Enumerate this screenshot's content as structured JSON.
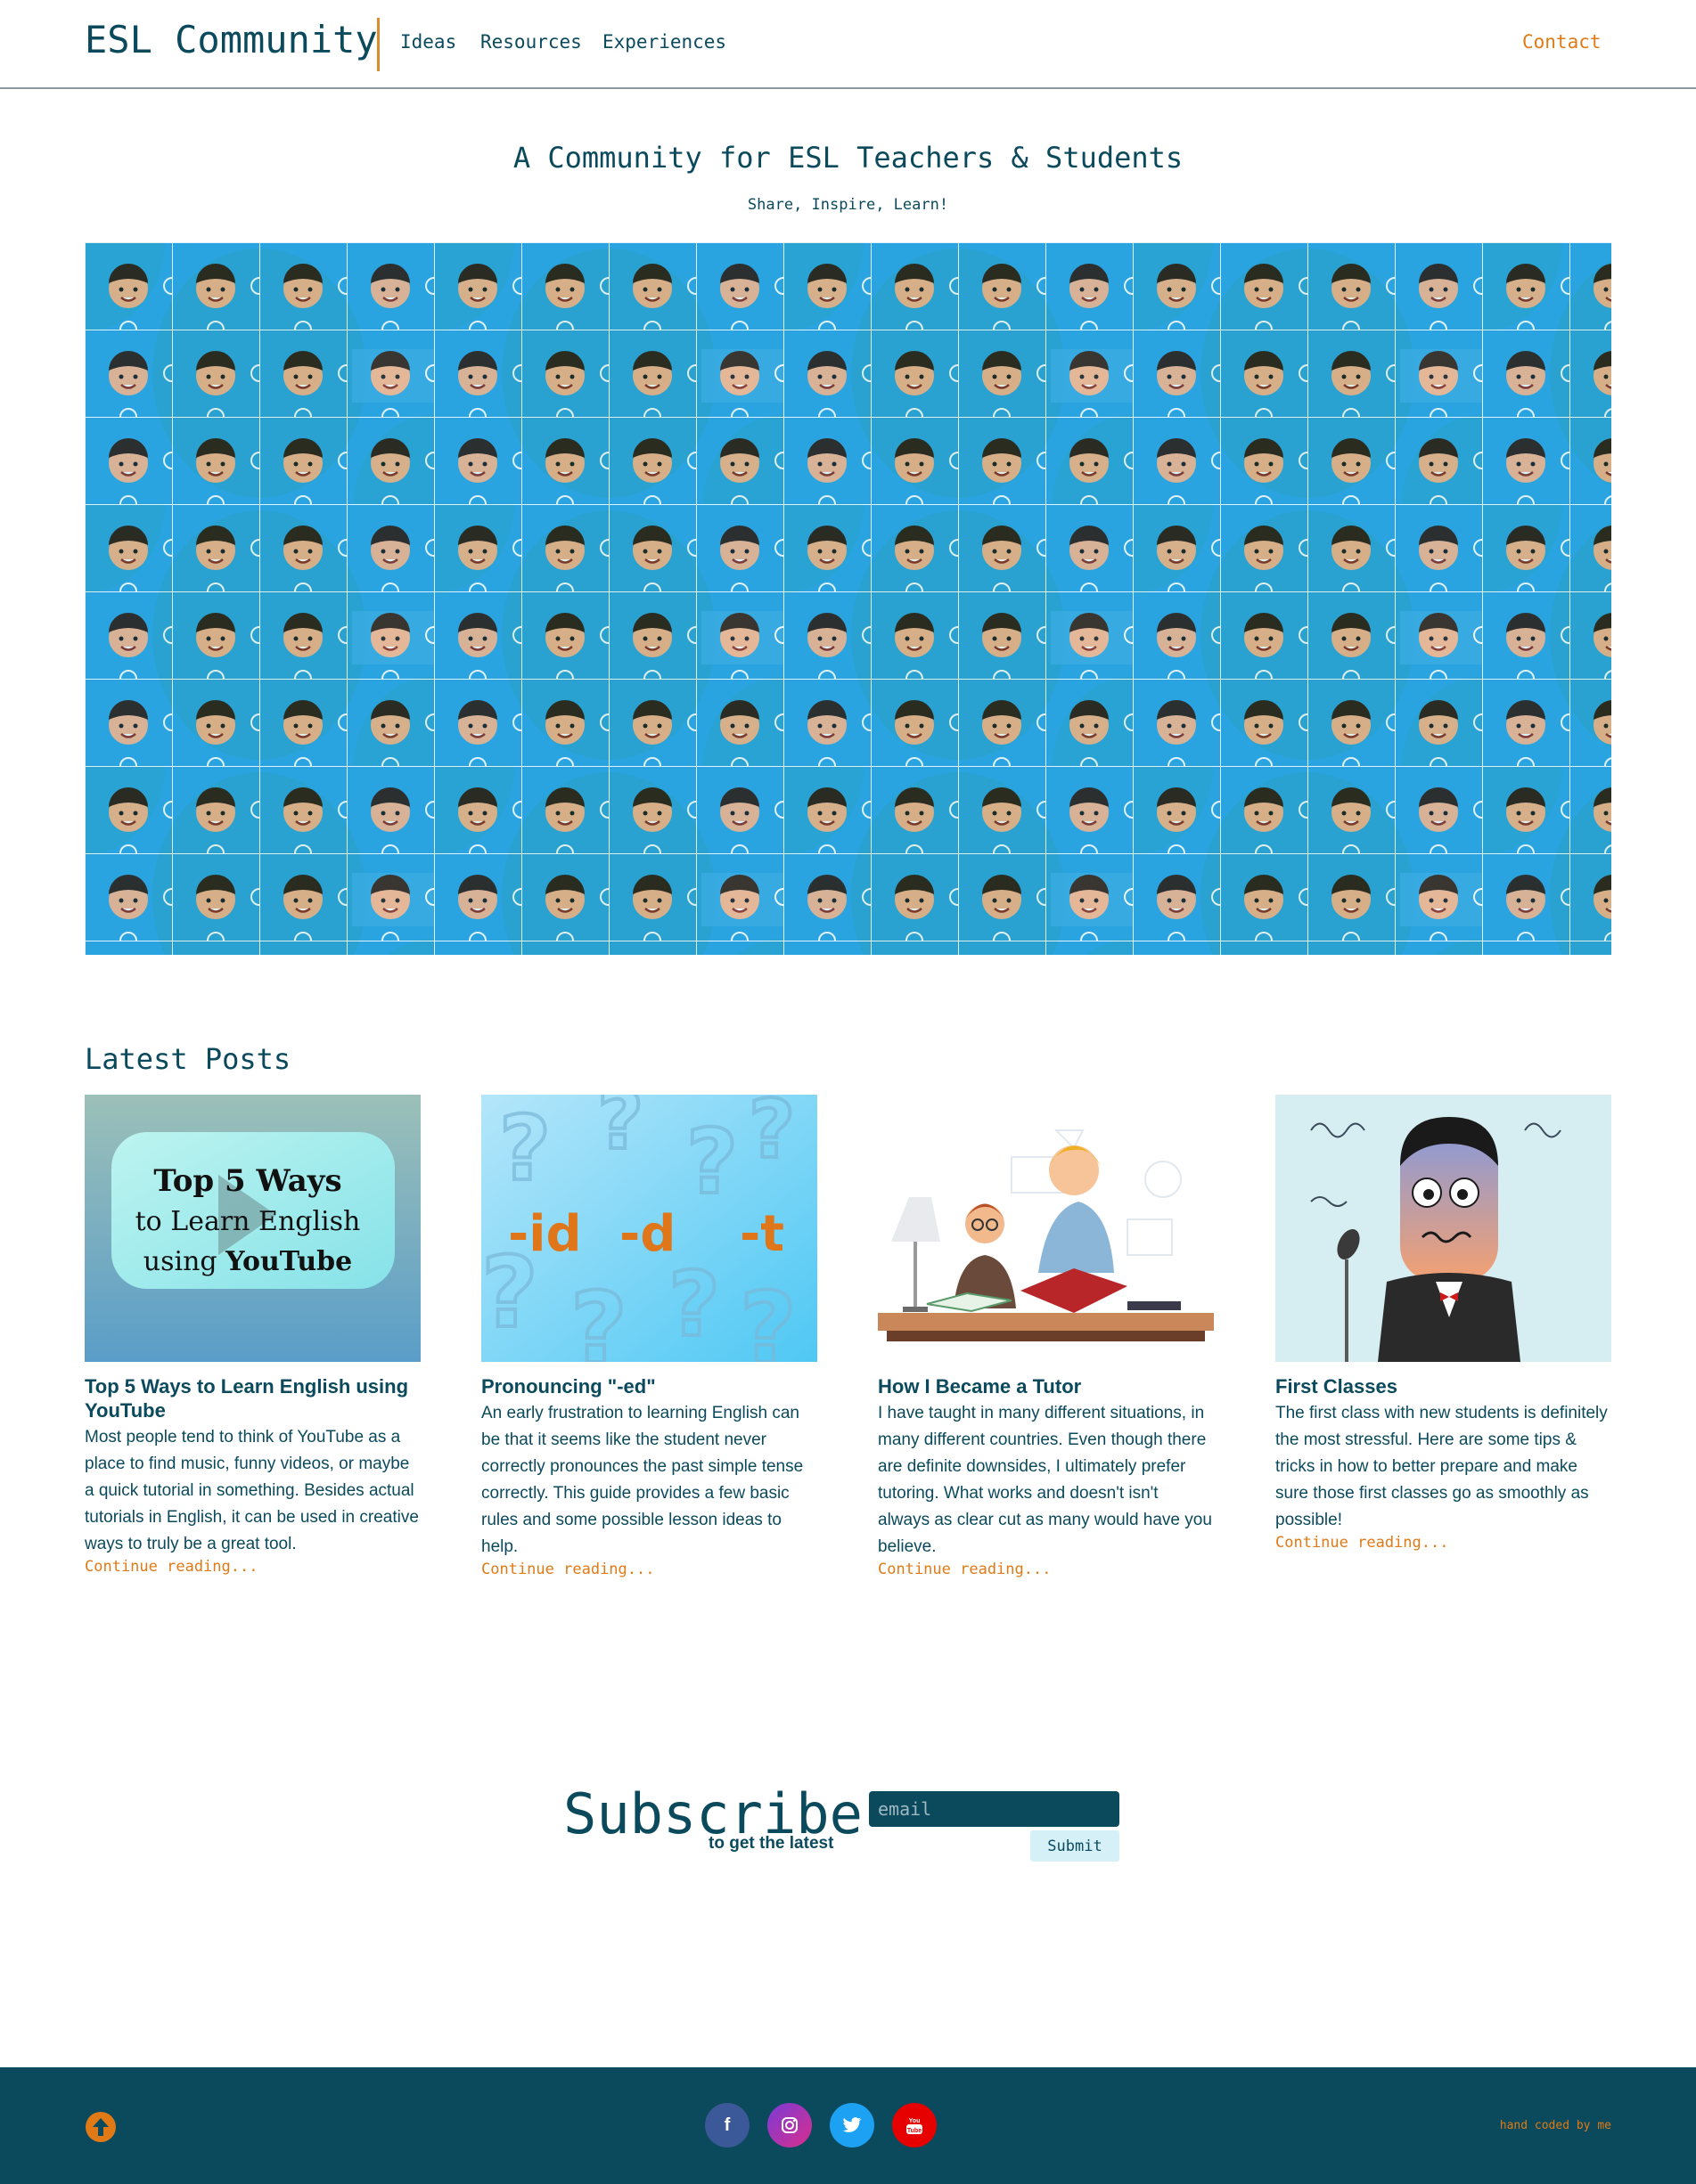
{
  "header": {
    "brand": "ESL Community",
    "nav": [
      {
        "label": "Ideas"
      },
      {
        "label": "Resources"
      },
      {
        "label": "Experiences"
      }
    ],
    "contact": "Contact"
  },
  "hero": {
    "title": "A Community for ESL Teachers & Students",
    "subtitle": "Share, Inspire, Learn!"
  },
  "latest": {
    "title": "Latest Posts",
    "posts": [
      {
        "thumb_line1": "Top 5 Ways",
        "thumb_line2": "to Learn English",
        "thumb_line3a": "using ",
        "thumb_line3b": "YouTube",
        "title": "Top 5 Ways to Learn English using YouTube",
        "excerpt": "Most people tend to think of YouTube as a place to find music, funny videos, or maybe a quick tutorial in something. Besides actual tutorials in English, it can be used in creative ways to truly be a great tool.",
        "more": "Continue reading..."
      },
      {
        "thumb_labels": [
          "-id",
          "-d",
          "-t"
        ],
        "title": "Pronouncing \"-ed\"",
        "excerpt": "An early frustration to learning English can be that it seems like the student never correctly pronounces the past simple tense correctly. This guide provides a few basic rules and some possible lesson ideas to help.",
        "more": "Continue reading..."
      },
      {
        "title": "How I Became a Tutor",
        "excerpt": "I have taught in many different situations, in many different countries. Even though there are definite downsides, I ultimately prefer tutoring. What works and doesn't isn't always as clear cut as many would have you believe.",
        "more": "Continue reading..."
      },
      {
        "title": "First Classes",
        "excerpt": "The first class with new students is definitely the most stressful. Here are some tips & tricks in how to better prepare and make sure those first classes go as smoothly as possible!",
        "more": "Continue reading..."
      }
    ]
  },
  "subscribe": {
    "title": "Subscribe",
    "caption": "to get the latest",
    "placeholder": "email",
    "button": "Submit"
  },
  "footer": {
    "social": [
      {
        "icon": "facebook-icon",
        "glyph": "f",
        "color": "#3b5998"
      },
      {
        "icon": "instagram-icon",
        "glyph": "◎",
        "color": "#b5289a"
      },
      {
        "icon": "twitter-icon",
        "glyph": "🐦",
        "color": "#1da1f2"
      },
      {
        "icon": "youtube-icon",
        "glyph": "▶",
        "color": "#e60000"
      }
    ],
    "credit": "hand coded by me",
    "back_to_top_color": "#e07a16"
  }
}
